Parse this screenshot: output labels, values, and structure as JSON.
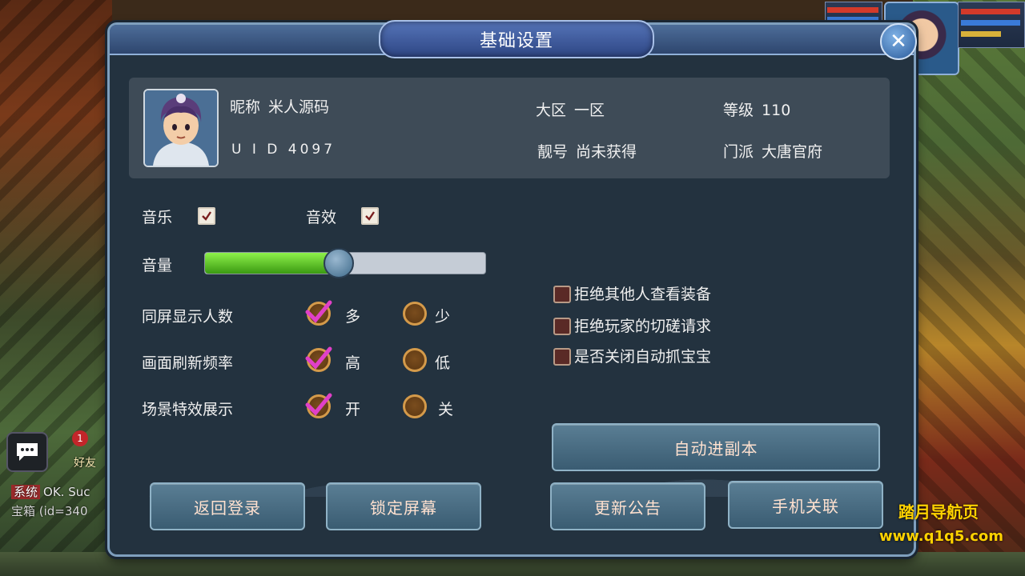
{
  "panel": {
    "title": "基础设置",
    "close_label": "✕"
  },
  "profile": {
    "nickname_label": "昵称",
    "nickname": "米人源码",
    "uid_text": "U I D 4097",
    "region_label": "大区",
    "region": "一区",
    "title_label": "靓号",
    "title_value": "尚未获得",
    "level_label": "等级",
    "level": "110",
    "sect_label": "门派",
    "sect": "大唐官府"
  },
  "audio": {
    "music_label": "音乐",
    "music_checked": true,
    "sfx_label": "音效",
    "sfx_checked": true,
    "volume_label": "音量",
    "volume_fraction": 0.47
  },
  "options": [
    {
      "label": "同屏显示人数",
      "opt_a": "多",
      "opt_b": "少",
      "selected": "a"
    },
    {
      "label": "画面刷新频率",
      "opt_a": "高",
      "opt_b": "低",
      "selected": "a"
    },
    {
      "label": "场景特效展示",
      "opt_a": "开",
      "opt_b": "关",
      "selected": "a"
    }
  ],
  "privacy": [
    {
      "label": "拒绝其他人查看装备",
      "checked": false
    },
    {
      "label": "拒绝玩家的切磋请求",
      "checked": false
    },
    {
      "label": "是否关闭自动抓宝宝",
      "checked": false
    }
  ],
  "buttons": {
    "auto_dungeon": "自动进副本",
    "back_login": "返回登录",
    "lock_screen": "锁定屏幕",
    "update_notice": "更新公告",
    "phone_link": "手机关联"
  },
  "hud": {
    "friend_label": "好友",
    "friend_badge": "1",
    "sys_tag": "系统",
    "sys_line1": "OK. Suc",
    "sys_line2": "宝箱 (id=340"
  },
  "watermark": {
    "line1": "踏月导航页",
    "line2": "www.q1q5.com"
  },
  "colors": {
    "panel_bg": "#23323f",
    "accent_green": "#5ac41e",
    "check_magenta": "#e040c8",
    "watermark_yellow": "#ffd200"
  }
}
